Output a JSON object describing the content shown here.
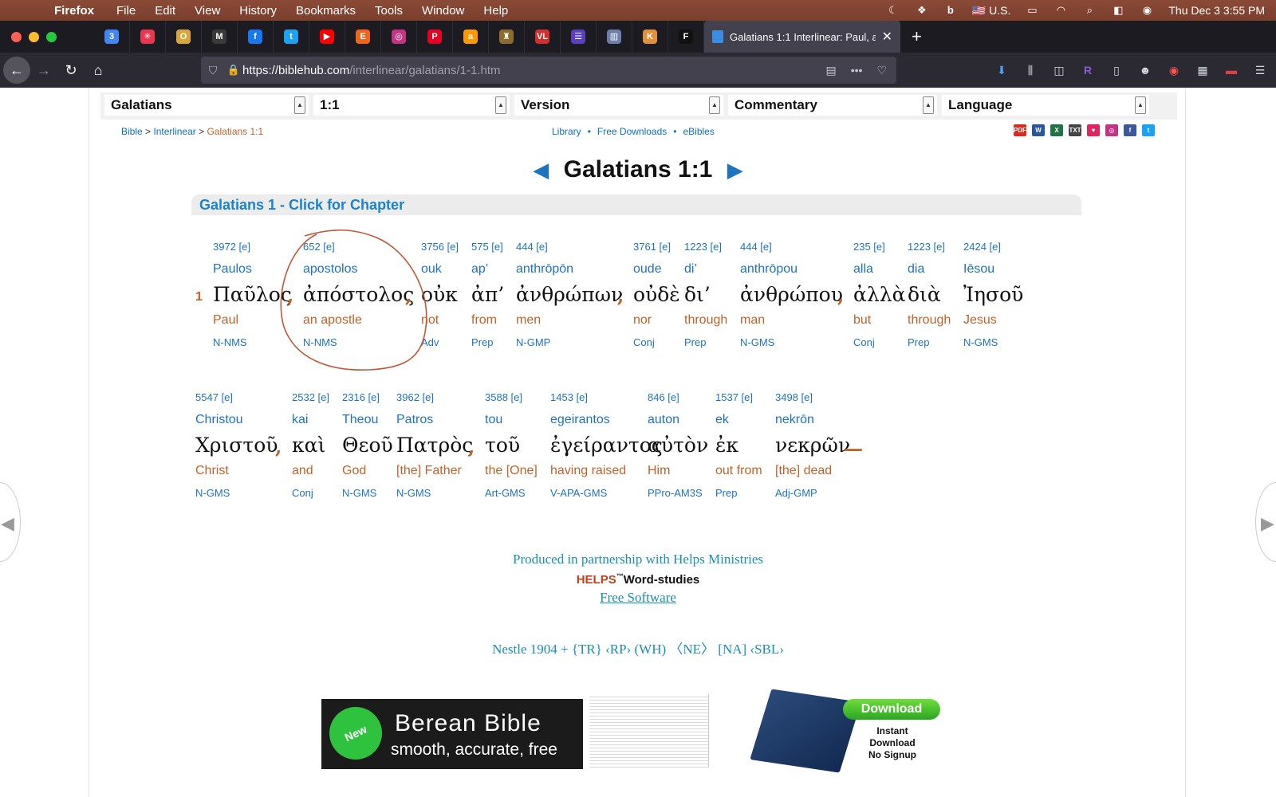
{
  "menubar": {
    "apple": "",
    "app_name": "Firefox",
    "items": [
      "File",
      "Edit",
      "View",
      "History",
      "Bookmarks",
      "Tools",
      "Window",
      "Help"
    ],
    "input_source": "U.S.",
    "clock": "Thu Dec 3  3:55 PM"
  },
  "tabs": {
    "pinned": [
      {
        "icon": "calendar-icon",
        "color": "#4285f4",
        "glyph": "3"
      },
      {
        "icon": "asana-icon",
        "color": "#e8384f",
        "glyph": "✳"
      },
      {
        "icon": "outlook-icon",
        "color": "#d7a73a",
        "glyph": "O"
      },
      {
        "icon": "gmail-icon",
        "color": "#3a3a3a",
        "glyph": "M"
      },
      {
        "icon": "facebook-icon",
        "color": "#1877f2",
        "glyph": "f"
      },
      {
        "icon": "twitter-icon",
        "color": "#1da1f2",
        "glyph": "t"
      },
      {
        "icon": "youtube-icon",
        "color": "#ff0000",
        "glyph": "▶"
      },
      {
        "icon": "etsy-icon",
        "color": "#f1641e",
        "glyph": "E"
      },
      {
        "icon": "instagram-icon",
        "color": "#c13584",
        "glyph": "◎"
      },
      {
        "icon": "pinterest-icon",
        "color": "#e60023",
        "glyph": "P"
      },
      {
        "icon": "amazon-icon",
        "color": "#ff9900",
        "glyph": "a"
      },
      {
        "icon": "crest-icon",
        "color": "#8c6b2f",
        "glyph": "♜"
      },
      {
        "icon": "vl-icon",
        "color": "#d32f2f",
        "glyph": "VL"
      },
      {
        "icon": "list-icon",
        "color": "#5a3fc0",
        "glyph": "☰"
      },
      {
        "icon": "library-icon",
        "color": "#6b7fa8",
        "glyph": "▥"
      },
      {
        "icon": "k-icon",
        "color": "#e0913a",
        "glyph": "K"
      },
      {
        "icon": "f-icon",
        "color": "#111111",
        "glyph": "F"
      }
    ],
    "active_title": "Galatians 1:1 Interlinear: Paul, an",
    "close": "✕",
    "new_tab": "+"
  },
  "navbar": {
    "url_host": "https://biblehub.com",
    "url_path": "/interlinear/galatians/1-1.htm"
  },
  "selectors": {
    "book": "Galatians",
    "chapter_verse": "1:1",
    "version": "Version",
    "commentary": "Commentary",
    "language": "Language"
  },
  "breadcrumb": {
    "bible": "Bible",
    "sep": ">",
    "interlinear": "Interlinear",
    "current": "Galatians 1:1"
  },
  "links": {
    "library": "Library",
    "downloads": "Free Downloads",
    "ebibles": "eBibles",
    "dot": "•"
  },
  "share_icons": [
    {
      "name": "pdf-icon",
      "color": "#d62d20",
      "glyph": "PDF"
    },
    {
      "name": "word-icon",
      "color": "#2b579a",
      "glyph": "W"
    },
    {
      "name": "excel-icon",
      "color": "#217346",
      "glyph": "X"
    },
    {
      "name": "txt-icon",
      "color": "#444444",
      "glyph": "TXT"
    },
    {
      "name": "heart-icon",
      "color": "#e0245e",
      "glyph": "♥"
    },
    {
      "name": "instagram-icon",
      "color": "#c13584",
      "glyph": "◎"
    },
    {
      "name": "facebook-icon",
      "color": "#3b5998",
      "glyph": "f"
    },
    {
      "name": "twitter-icon",
      "color": "#1da1f2",
      "glyph": "t"
    }
  ],
  "verse_title": "Galatians 1:1",
  "prev_arrow": "◀",
  "next_arrow": "▶",
  "chapter_link": "Galatians 1 - Click for Chapter",
  "verse_number": "1",
  "row1": [
    {
      "strong": "3972 [e]",
      "translit": "Paulos",
      "greek": "Παῦλος",
      "english": "Paul",
      "parse": "N-NMS"
    },
    {
      "strong": "652 [e]",
      "translit": "apostolos",
      "greek": "ἀπόστολος",
      "english": "an apostle",
      "parse": "N-NMS"
    },
    {
      "strong": "3756 [e]",
      "translit": "ouk",
      "greek": "οὐκ",
      "english": "not",
      "parse": "Adv"
    },
    {
      "strong": "575 [e]",
      "translit": "ap’",
      "greek": "ἀπ’",
      "english": "from",
      "parse": "Prep"
    },
    {
      "strong": "444 [e]",
      "translit": "anthrōpōn",
      "greek": "ἀνθρώπων",
      "english": "men",
      "parse": "N-GMP"
    },
    {
      "strong": "3761 [e]",
      "translit": "oude",
      "greek": "οὐδὲ",
      "english": "nor",
      "parse": "Conj"
    },
    {
      "strong": "1223 [e]",
      "translit": "di’",
      "greek": "δι’",
      "english": "through",
      "parse": "Prep"
    },
    {
      "strong": "444 [e]",
      "translit": "anthrōpou",
      "greek": "ἀνθρώπου",
      "english": "man",
      "parse": "N-GMS"
    },
    {
      "strong": "235 [e]",
      "translit": "alla",
      "greek": "ἀλλὰ",
      "english": "but",
      "parse": "Conj"
    },
    {
      "strong": "1223 [e]",
      "translit": "dia",
      "greek": "διὰ",
      "english": "through",
      "parse": "Prep"
    },
    {
      "strong": "2424 [e]",
      "translit": "Iēsou",
      "greek": "Ἰησοῦ",
      "english": "Jesus",
      "parse": "N-GMS"
    }
  ],
  "row2": [
    {
      "strong": "5547 [e]",
      "translit": "Christou",
      "greek": "Χριστοῦ",
      "english": "Christ",
      "parse": "N-GMS"
    },
    {
      "strong": "2532 [e]",
      "translit": "kai",
      "greek": "καὶ",
      "english": "and",
      "parse": "Conj"
    },
    {
      "strong": "2316 [e]",
      "translit": "Theou",
      "greek": "Θεοῦ",
      "english": "God",
      "parse": "N-GMS"
    },
    {
      "strong": "3962 [e]",
      "translit": "Patros",
      "greek": "Πατρὸς",
      "english": "[the] Father",
      "parse": "N-GMS"
    },
    {
      "strong": "3588 [e]",
      "translit": "tou",
      "greek": "τοῦ",
      "english": "the [One]",
      "parse": "Art-GMS"
    },
    {
      "strong": "1453 [e]",
      "translit": "egeirantos",
      "greek": "ἐγείραντος",
      "english": "having raised",
      "parse": "V-APA-GMS"
    },
    {
      "strong": "846 [e]",
      "translit": "auton",
      "greek": "αὐτὸν",
      "english": "Him",
      "parse": "PPro-AM3S"
    },
    {
      "strong": "1537 [e]",
      "translit": "ek",
      "greek": "ἐκ",
      "english": "out from",
      "parse": "Prep"
    },
    {
      "strong": "3498 [e]",
      "translit": "nekrōn",
      "greek": "νεκρῶν",
      "english": "[the] dead",
      "parse": "Adj-GMP"
    }
  ],
  "punct": {
    "comma": ",",
    "dash": "—"
  },
  "footer": {
    "partner": "Produced in partnership with Helps Ministries",
    "helps_mark": "HELPS",
    "helps_tm": "™",
    "helps_rest": "Word-studies",
    "free_software": "Free Software",
    "editions": "Nestle 1904 + {TR} ‹RP› (WH) 〈NE〉 [NA] ‹SBL›"
  },
  "banner": {
    "badge": "New",
    "title": "Berean Bible",
    "subtitle": "smooth, accurate, free",
    "download": "Download",
    "instant": [
      "Instant",
      "Download",
      "No Signup"
    ]
  },
  "colors": {
    "link_blue": "#1e73be",
    "orange": "#c0622a",
    "annotation": "#c0573a"
  }
}
